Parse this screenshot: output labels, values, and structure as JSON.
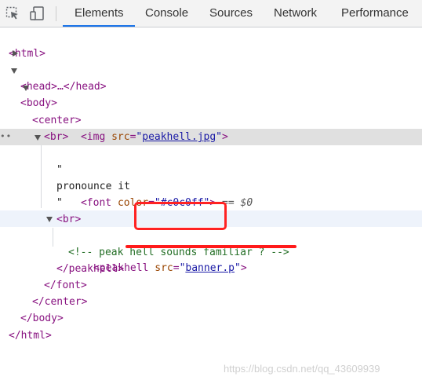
{
  "tabs": [
    {
      "label": "Elements",
      "active": true
    },
    {
      "label": "Console",
      "active": false
    },
    {
      "label": "Sources",
      "active": false
    },
    {
      "label": "Network",
      "active": false
    },
    {
      "label": "Performance",
      "active": false
    }
  ],
  "icons": {
    "inspect": "inspect-element-icon",
    "device": "device-toolbar-icon",
    "more": "more-options-icon"
  },
  "tree": {
    "html_open": "<html>",
    "head": "<head>…</head>",
    "body_open": "<body>",
    "center_open": "<center>",
    "img_tag": "<img ",
    "img_attr": "src",
    "img_value": "peakhell.jpg",
    "img_close": ">",
    "br1": "<br>",
    "font_tag": "<font ",
    "font_attr": "color",
    "font_value": "#c0c0ff",
    "font_close": ">",
    "selected_marker": " == $0",
    "quote1": "\"",
    "text": "pronounce it",
    "quote2": "\"",
    "br2": "<br>",
    "peakhell_tag": "<peakhell ",
    "peakhell_attr": "src",
    "peakhell_value": "banner.p",
    "peakhell_close": ">",
    "comment": "<!-- peak hell sounds familiar ? -->",
    "peakhell_end": "</peakhell>",
    "font_end": "</font>",
    "center_end": "</center>",
    "body_end": "</body>",
    "html_end": "</html>"
  },
  "watermark": "https://blog.csdn.net/qq_43609939",
  "colors": {
    "highlight_box": "#ff2222",
    "tab_accent": "#1a73e8"
  }
}
